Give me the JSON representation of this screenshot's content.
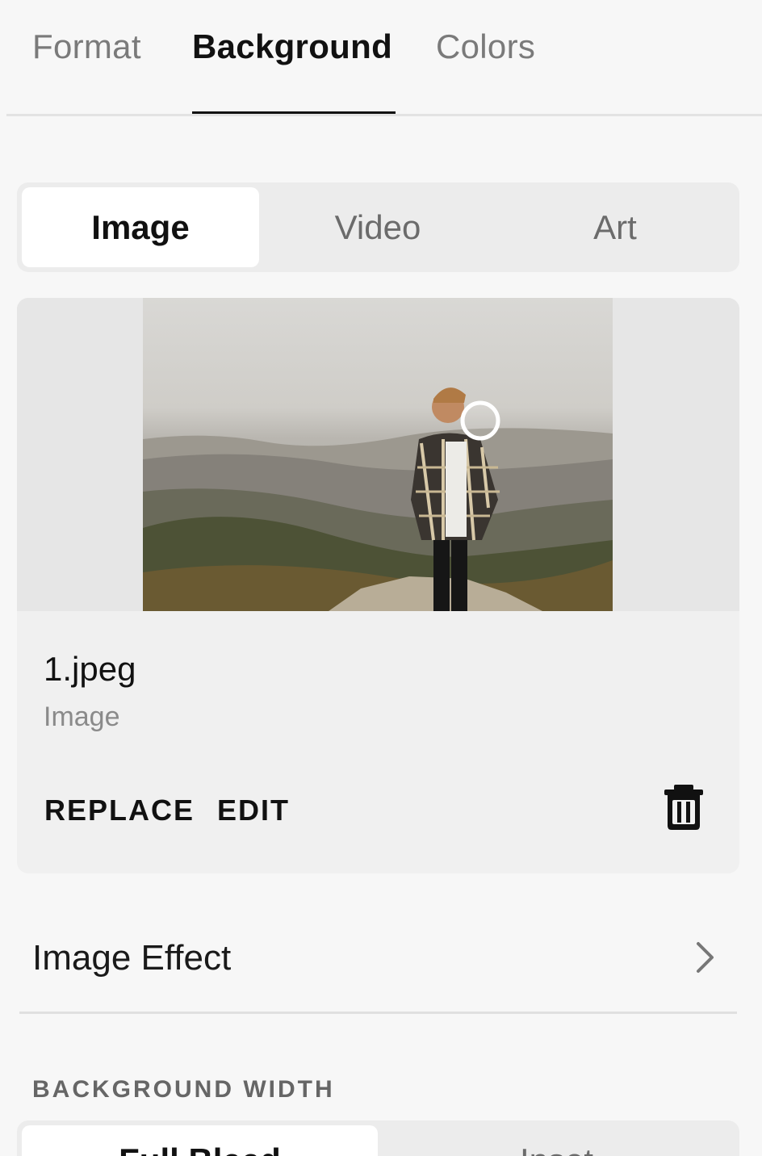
{
  "top_tabs": {
    "items": [
      {
        "label": "Format",
        "active": false
      },
      {
        "label": "Background",
        "active": true
      },
      {
        "label": "Colors",
        "active": false
      }
    ]
  },
  "media_type": {
    "options": [
      {
        "label": "Image",
        "active": true
      },
      {
        "label": "Video",
        "active": false
      },
      {
        "label": "Art",
        "active": false
      }
    ]
  },
  "image_card": {
    "file_name": "1.jpeg",
    "file_type": "Image",
    "replace_label": "REPLACE",
    "edit_label": "EDIT",
    "delete_icon": "trash-icon",
    "focal_point_icon": "focal-point-circle-icon"
  },
  "image_effect": {
    "label": "Image Effect",
    "icon": "chevron-right-icon"
  },
  "background_width": {
    "section_label": "BACKGROUND WIDTH",
    "options": [
      {
        "label": "Full Bleed",
        "active": true
      },
      {
        "label": "Inset",
        "active": false
      }
    ]
  },
  "colors": {
    "accent": "#111111",
    "muted_text": "#7a7a7a",
    "card_bg": "#f0f0f0"
  }
}
